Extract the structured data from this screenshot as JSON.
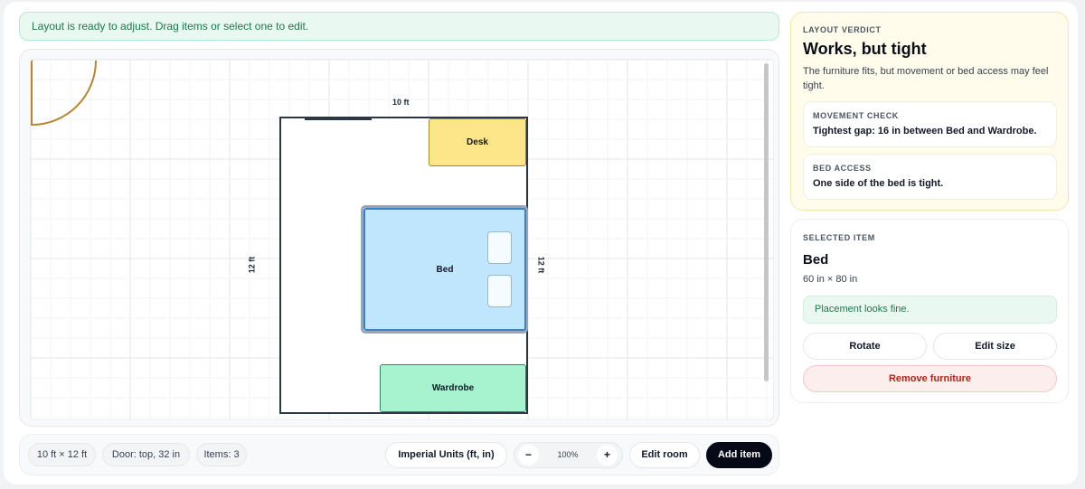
{
  "status": {
    "message": "Layout is ready to adjust. Drag items or select one to edit."
  },
  "room": {
    "width_label": "10 ft",
    "height_label": "12 ft",
    "height_label_right": "12 ft"
  },
  "furniture": {
    "desk": {
      "label": "Desk"
    },
    "bed": {
      "label": "Bed"
    },
    "wardrobe": {
      "label": "Wardrobe"
    }
  },
  "toolbar": {
    "room_size": "10 ft × 12 ft",
    "door": "Door: top, 32 in",
    "items": "Items: 3",
    "units_label": "Imperial Units (ft, in)",
    "zoom_minus": "−",
    "zoom_level": "100%",
    "zoom_plus": "+",
    "edit_room_label": "Edit room",
    "add_item_label": "Add item"
  },
  "verdict": {
    "eyebrow": "LAYOUT VERDICT",
    "title": "Works, but tight",
    "description": "The furniture fits, but movement or bed access may feel tight.",
    "movement": {
      "eyebrow": "MOVEMENT CHECK",
      "text": "Tightest gap: 16 in between Bed and Wardrobe."
    },
    "bed_access": {
      "eyebrow": "BED ACCESS",
      "text": "One side of the bed is tight."
    }
  },
  "selected": {
    "eyebrow": "SELECTED ITEM",
    "name": "Bed",
    "size": "60 in × 80 in",
    "placement": "Placement looks fine.",
    "rotate_label": "Rotate",
    "edit_size_label": "Edit size",
    "remove_label": "Remove furniture"
  },
  "colors": {
    "desk": "#fde68a",
    "bed": "#bfe6fd",
    "wardrobe": "#a7f3d0",
    "door": "#b7852f",
    "wall": "#2b3744"
  }
}
